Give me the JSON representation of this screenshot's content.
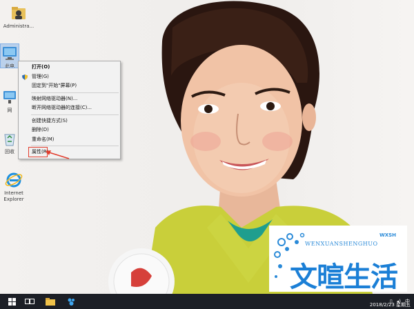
{
  "desktop_icons": [
    {
      "id": "user-folder",
      "label": "Administra..."
    },
    {
      "id": "this-pc",
      "label": "此电"
    },
    {
      "id": "network",
      "label": "网"
    },
    {
      "id": "recycle-bin",
      "label": "回收"
    },
    {
      "id": "internet-explorer",
      "label": "Internet\nExplorer"
    }
  ],
  "context_menu": {
    "items": [
      {
        "label": "打开(O)",
        "bold": true
      },
      {
        "label": "管理(G)",
        "icon": "shield-icon"
      },
      {
        "label": "固定到\"开始\"屏幕(P)"
      },
      {
        "separator": true
      },
      {
        "label": "映射网络驱动器(N)..."
      },
      {
        "label": "断开网络驱动器的连接(C)..."
      },
      {
        "separator": true
      },
      {
        "label": "创建快捷方式(S)"
      },
      {
        "label": "删除(D)"
      },
      {
        "label": "重命名(M)"
      },
      {
        "separator": true
      },
      {
        "label": "属性(R)",
        "highlighted": true
      }
    ]
  },
  "watermark": {
    "latin": "WENXUANSHENGHUO",
    "tiny": "WXSH",
    "chinese": "文暄生活"
  },
  "taskbar": {
    "date": "2018/2/23 星期五",
    "icons": [
      "windows-start-icon",
      "task-view-icon",
      "file-explorer-icon",
      "store-icon"
    ]
  },
  "colors": {
    "taskbar": "#1c1f26",
    "menu_bg": "#f2f2f2",
    "highlight_box": "#e23c2c",
    "logo_blue": "#1b7fd6"
  }
}
